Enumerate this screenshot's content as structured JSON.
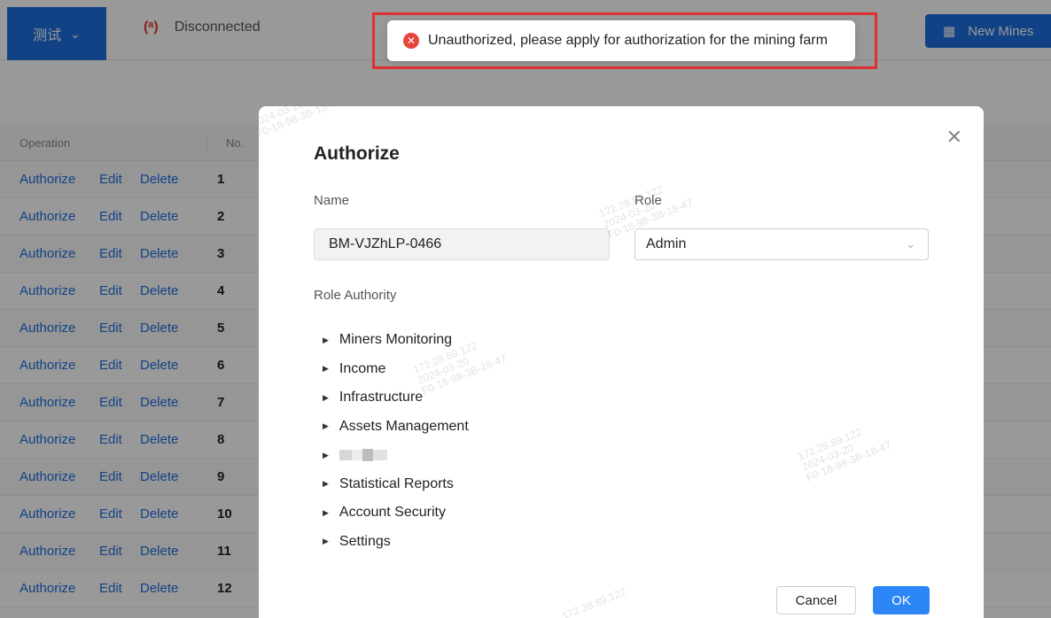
{
  "topbar": {
    "project": "测试",
    "connection_status": "Disconnected",
    "new_mines": "New Mines"
  },
  "toast": {
    "message": "Unauthorized, please apply for authorization for the mining farm"
  },
  "table": {
    "headers": {
      "operation": "Operation",
      "no": "No."
    },
    "actions": {
      "authorize": "Authorize",
      "edit": "Edit",
      "delete": "Delete"
    },
    "rows": [
      "1",
      "2",
      "3",
      "4",
      "5",
      "6",
      "7",
      "8",
      "9",
      "10",
      "11",
      "12"
    ]
  },
  "modal": {
    "title": "Authorize",
    "name_label": "Name",
    "name_value": "BM-VJZhLP-0466",
    "role_label": "Role",
    "role_value": "Admin",
    "authority_label": "Role Authority",
    "authorities": [
      "Miners Monitoring",
      "Income",
      "Infrastructure",
      "Assets Management",
      "",
      "Statistical Reports",
      "Account Security",
      "Settings"
    ],
    "cancel": "Cancel",
    "ok": "OK"
  },
  "watermark": {
    "ip": "172.28.89.122",
    "date": "2024-03-20",
    "mac": "F0-18-98-3B-18-47"
  },
  "colors": {
    "primary": "#1f6fe0",
    "error": "#e8453c",
    "ok_button": "#2d86f5"
  }
}
